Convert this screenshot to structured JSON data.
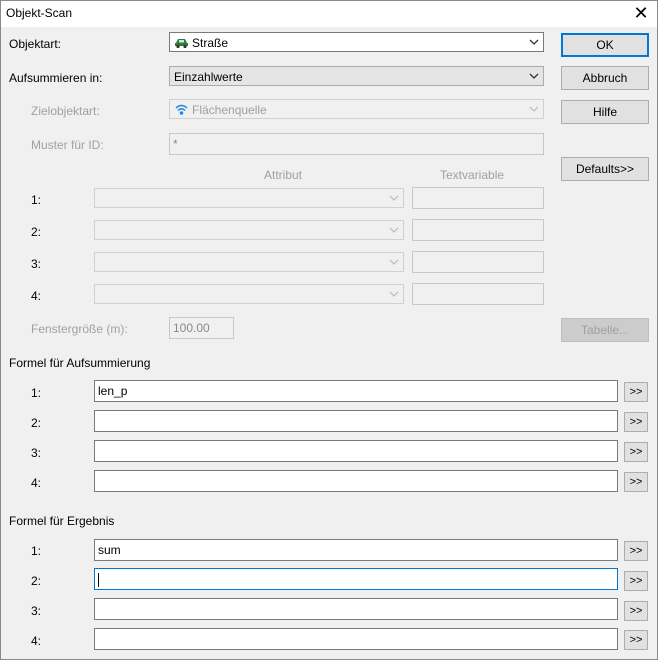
{
  "window": {
    "title": "Objekt-Scan",
    "close_glyph": "✕"
  },
  "objektart": {
    "label": "Objektart:",
    "value": "Straße",
    "icon": "car-icon"
  },
  "aufsummieren": {
    "label": "Aufsummieren in:",
    "value": "Einzahlwerte"
  },
  "zielobjektart": {
    "label": "Zielobjektart:",
    "value": "Flächenquelle",
    "icon": "area-source-icon"
  },
  "muster": {
    "label": "Muster für ID:",
    "value": "*"
  },
  "attribute_section": {
    "col_attribut": "Attribut",
    "col_textvariable": "Textvariable",
    "rows": [
      {
        "label": "1:",
        "attribut": "",
        "textvariable": ""
      },
      {
        "label": "2:",
        "attribut": "",
        "textvariable": ""
      },
      {
        "label": "3:",
        "attribut": "",
        "textvariable": ""
      },
      {
        "label": "4:",
        "attribut": "",
        "textvariable": ""
      }
    ]
  },
  "fenstergroesse": {
    "label": "Fenstergröße (m):",
    "value": "100.00"
  },
  "formel_aufsummierung": {
    "heading": "Formel für Aufsummierung",
    "rows": [
      {
        "label": "1:",
        "value": "len_p",
        "button": ">>"
      },
      {
        "label": "2:",
        "value": "",
        "button": ">>"
      },
      {
        "label": "3:",
        "value": "",
        "button": ">>"
      },
      {
        "label": "4:",
        "value": "",
        "button": ">>"
      }
    ]
  },
  "formel_ergebnis": {
    "heading": "Formel für Ergebnis",
    "rows": [
      {
        "label": "1:",
        "value": "sum",
        "button": ">>"
      },
      {
        "label": "2:",
        "value": "",
        "button": ">>"
      },
      {
        "label": "3:",
        "value": "",
        "button": ">>"
      },
      {
        "label": "4:",
        "value": "",
        "button": ">>"
      }
    ]
  },
  "buttons": {
    "ok": "OK",
    "abbruch": "Abbruch",
    "hilfe": "Hilfe",
    "defaults": "Defaults>>",
    "tabelle": "Tabelle..."
  },
  "colors": {
    "focus_border": "#0078d7",
    "disabled_text": "#a0a0a0",
    "dialog_bg": "#f0f0f0"
  }
}
